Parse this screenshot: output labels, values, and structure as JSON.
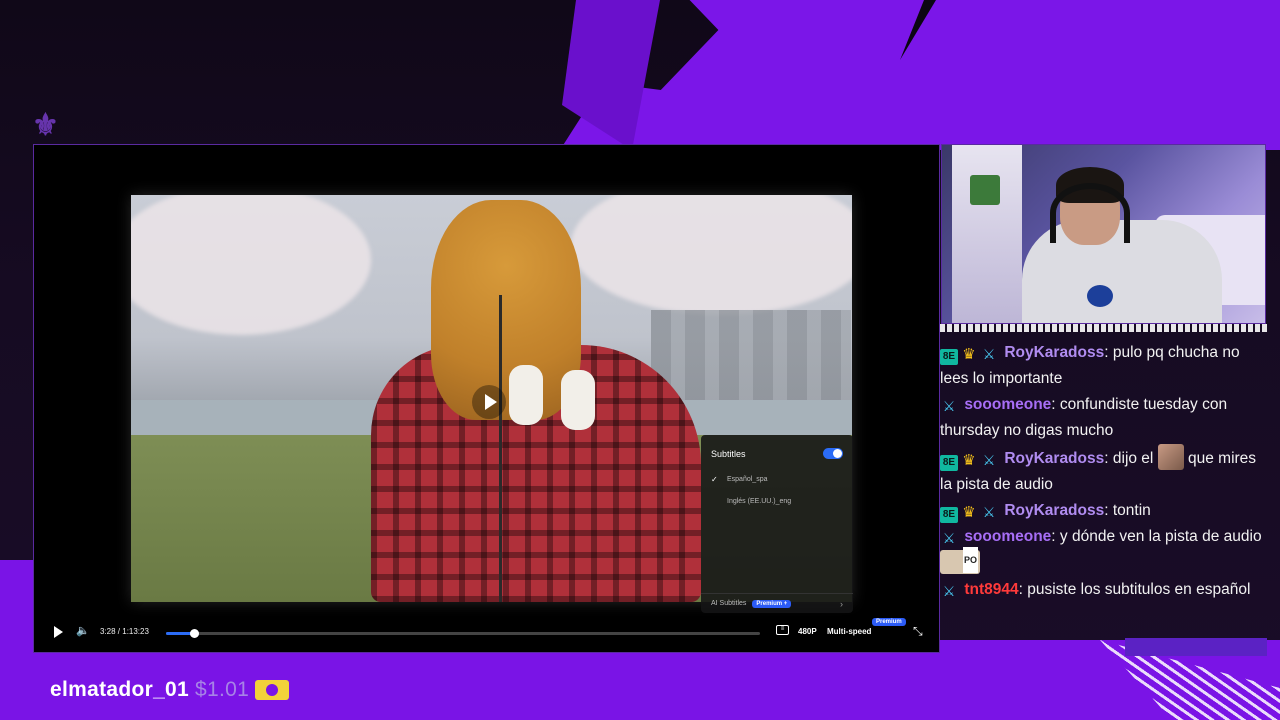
{
  "player": {
    "time": "3:28 / 1:13:23",
    "progress": 0.047,
    "quality": "480P",
    "speed": "Multi-speed",
    "premium_tag": "Premium",
    "subtitles_menu": {
      "title": "Subtitles",
      "enabled": true,
      "options": [
        {
          "label": "Español_spa",
          "checked": true
        },
        {
          "label": "Inglés (EE.UU.)_eng",
          "checked": false
        }
      ],
      "ai_label": "AI Subtitles",
      "ai_badge": "Premium +"
    }
  },
  "chat": {
    "messages": [
      {
        "user": "RoyKaradoss",
        "text": "pulo pq chucha no lees lo importante"
      },
      {
        "user": "sooomeone",
        "text": "confundiste tuesday con thursday no digas mucho"
      },
      {
        "user": "RoyKaradoss",
        "text_before": "dijo el",
        "text_after": "que mires la pista de audio"
      },
      {
        "user": "RoyKaradoss",
        "text": "tontin"
      },
      {
        "user": "sooomeone",
        "text": "y dónde ven la pista de audio",
        "emote_label": "PO"
      },
      {
        "user": "tnt8944",
        "text": "pusiste los subtitulos en español"
      }
    ]
  },
  "donation": {
    "user": "elmatador_01",
    "amount": "$1.01"
  },
  "icons": {
    "play": "play-icon",
    "volume": "volume-icon",
    "captions": "captions-icon",
    "fullscreen": "exit-fullscreen-icon",
    "cash": "cash-icon"
  },
  "colors": {
    "accent": "#7a14e6",
    "player_blue": "#2b6cf6",
    "user_purple": "#a76ef6",
    "user_red": "#ff3a3a"
  }
}
